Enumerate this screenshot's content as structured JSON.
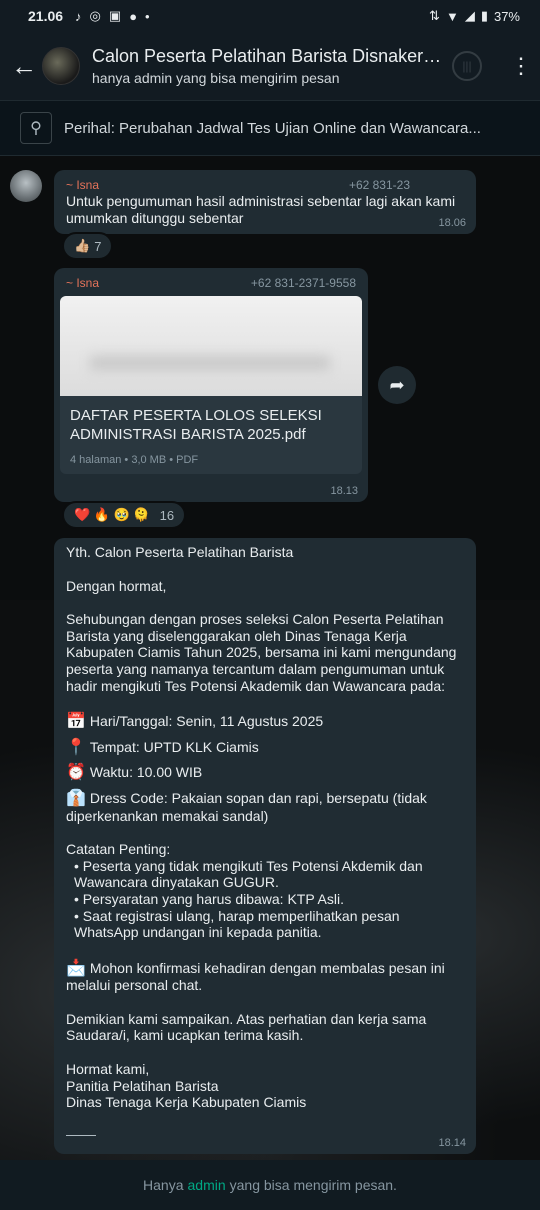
{
  "status_bar": {
    "time": "21.06",
    "battery": "37%"
  },
  "header": {
    "title": "Calon Peserta Pelatihan Barista Disnaker K...",
    "subtitle": "hanya admin yang bisa mengirim pesan"
  },
  "pinned": {
    "text": "Perihal: Perubahan Jadwal Tes Ujian Online dan Wawancara..."
  },
  "messages": [
    {
      "sender": "~ Isna",
      "phone": "+62 831-23",
      "text": "Untuk pengumuman hasil administrasi sebentar lagi akan kami umumkan ditunggu sebentar",
      "time": "18.06",
      "reaction": {
        "emoji": "👍🏼",
        "count": "7"
      }
    },
    {
      "sender": "~ Isna",
      "phone": "+62 831-2371-9558",
      "document": {
        "name": "DAFTAR PESERTA LOLOS SELEKSI ADMINISTRASI BARISTA 2025.pdf",
        "meta": "4 halaman • 3,0 MB • PDF"
      },
      "time": "18.13",
      "reaction": {
        "emoji": "❤️ 🔥 🥹 🫠",
        "count": "16"
      }
    },
    {
      "time": "18.14",
      "lines": {
        "greeting": "Yth. Calon Peserta Pelatihan Barista",
        "salutation": "Dengan hormat,",
        "intro": "Sehubungan dengan proses seleksi Calon Peserta Pelatihan Barista yang diselenggarakan oleh Dinas Tenaga Kerja Kabupaten Ciamis Tahun 2025, bersama ini kami mengundang peserta yang namanya tercantum dalam pengumuman untuk hadir mengikuti Tes Potensi Akademik dan Wawancara pada:",
        "date": "Hari/Tanggal: Senin, 11 Agustus 2025",
        "place": "Tempat: UPTD KLK Ciamis",
        "time_line": "Waktu: 10.00 WIB",
        "dress": "Dress Code: Pakaian sopan dan rapi, bersepatu (tidak diperkenankan memakai sandal)",
        "notes_title": "Catatan Penting:",
        "note1": "• Peserta yang tidak mengikuti Tes Potensi Akdemik dan Wawancara dinyatakan GUGUR.",
        "note2": "• Persyaratan yang harus dibawa: KTP Asli.",
        "note3": "• Saat registrasi ulang, harap memperlihatkan pesan WhatsApp undangan ini kepada panitia.",
        "confirm": "Mohon konfirmasi kehadiran dengan membalas pesan ini melalui personal chat.",
        "closing": "Demikian kami sampaikan. Atas perhatian dan kerja sama Saudara/i, kami ucapkan terima kasih.",
        "sign1": "Hormat kami,",
        "sign2": "Panitia Pelatihan Barista",
        "sign3": "Dinas Tenaga Kerja Kabupaten Ciamis"
      },
      "emojis": {
        "date": "📅",
        "place": "📍",
        "time_line": "⏰",
        "dress": "👔",
        "confirm": "📩"
      }
    }
  ],
  "footer": {
    "prefix": "Hanya",
    "highlight": "admin",
    "suffix": "yang bisa mengirim pesan."
  }
}
